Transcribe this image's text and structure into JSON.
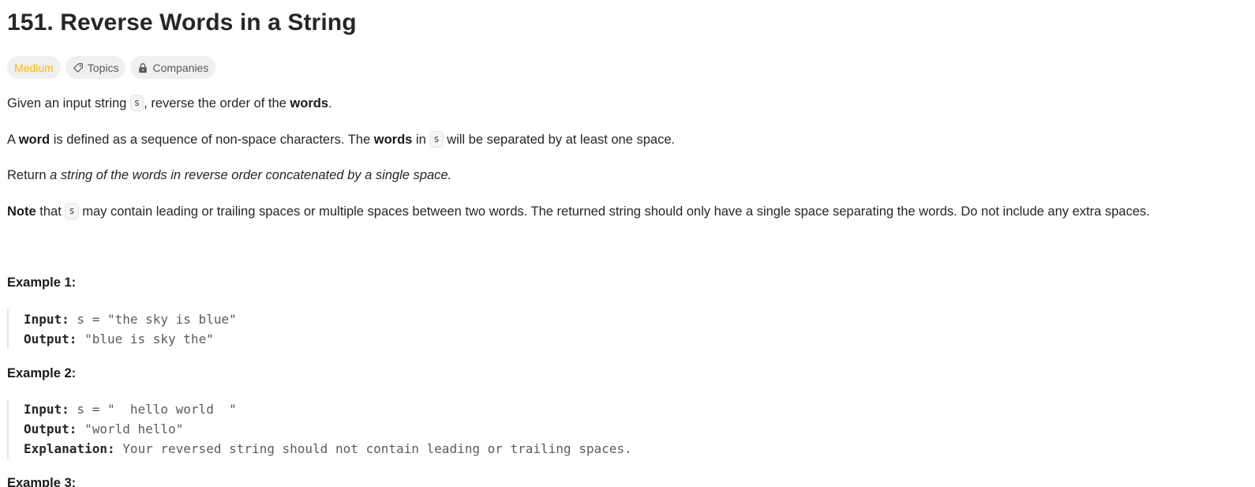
{
  "problem": {
    "title": "151. Reverse Words in a String",
    "tags": {
      "difficulty": "Medium",
      "topics": "Topics",
      "companies": "Companies",
      "topics_icon": "tag-icon",
      "companies_icon": "lock-icon"
    },
    "p1": {
      "pre": "Given an input string ",
      "code": "s",
      "mid": ", reverse the order of the ",
      "bold": "words",
      "post": "."
    },
    "p2": {
      "pre": "A ",
      "bold1": "word",
      "mid1": " is defined as a sequence of non-space characters. The ",
      "bold2": "words",
      "mid2": " in ",
      "code": "s",
      "post": " will be separated by at least one space."
    },
    "p3": {
      "pre": "Return ",
      "italic": "a string of the words in reverse order concatenated by a single space."
    },
    "p4": {
      "bold": "Note",
      "mid": " that ",
      "code": "s",
      "post": " may contain leading or trailing spaces or multiple spaces between two words. The returned string should only have a single space separating the words. Do not include any extra spaces."
    },
    "examples": [
      {
        "title": "Example 1:",
        "input_label": "Input:",
        "input_value": " s = \"the sky is blue\"",
        "output_label": "Output:",
        "output_value": " \"blue is sky the\""
      },
      {
        "title": "Example 2:",
        "input_label": "Input:",
        "input_value": " s = \"  hello world  \"",
        "output_label": "Output:",
        "output_value": " \"world hello\"",
        "explanation_label": "Explanation:",
        "explanation_value": " Your reversed string should not contain leading or trailing spaces."
      }
    ],
    "next_example_title": "Example 3:"
  }
}
